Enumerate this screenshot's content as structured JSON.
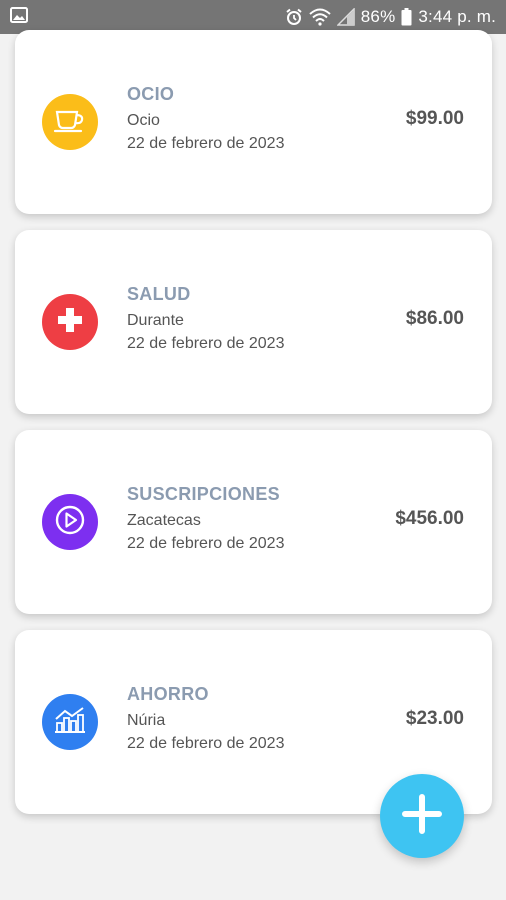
{
  "status_bar": {
    "battery": "86%",
    "time": "3:44 p. m."
  },
  "entries": [
    {
      "category": "OCIO",
      "description": "Ocio",
      "date": "22 de febrero de 2023",
      "amount": "$99.00",
      "color": "#fbbd19",
      "icon": "coffee-cup-icon"
    },
    {
      "category": "SALUD",
      "description": "Durante",
      "date": "22 de febrero de 2023",
      "amount": "$86.00",
      "color": "#ee3e44",
      "icon": "medical-cross-icon"
    },
    {
      "category": "SUSCRIPCIONES",
      "description": "Zacatecas",
      "date": "22 de febrero de 2023",
      "amount": "$456.00",
      "color": "#7d2ff0",
      "icon": "play-icon"
    },
    {
      "category": "AHORRO",
      "description": "Núria",
      "date": "22 de febrero de 2023",
      "amount": "$23.00",
      "color": "#2f7ff0",
      "icon": "savings-chart-icon"
    }
  ],
  "fab": {
    "icon": "plus-icon",
    "color": "#3ec4f2"
  }
}
